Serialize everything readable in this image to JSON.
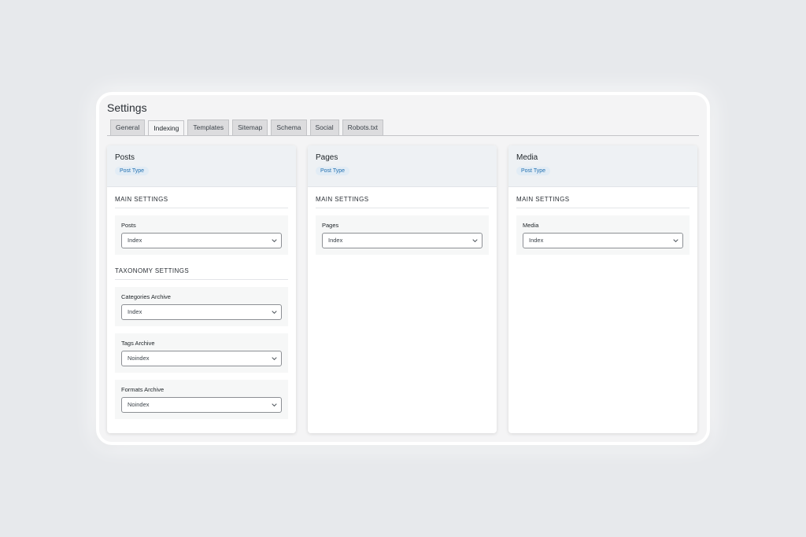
{
  "page_title": "Settings",
  "tabs": [
    "General",
    "Indexing",
    "Templates",
    "Sitemap",
    "Schema",
    "Social",
    "Robots.txt"
  ],
  "active_tab": "Indexing",
  "cards": {
    "posts": {
      "title": "Posts",
      "badge": "Post Type",
      "main_section": "MAIN SETTINGS",
      "posts_field": {
        "label": "Posts",
        "value": "Index"
      },
      "taxonomy_section": "TAXONOMY SETTINGS",
      "categories_field": {
        "label": "Categories Archive",
        "value": "Index"
      },
      "tags_field": {
        "label": "Tags Archive",
        "value": "Noindex"
      },
      "formats_field": {
        "label": "Formats Archive",
        "value": "Noindex"
      }
    },
    "pages": {
      "title": "Pages",
      "badge": "Post Type",
      "main_section": "MAIN SETTINGS",
      "pages_field": {
        "label": "Pages",
        "value": "Index"
      }
    },
    "media": {
      "title": "Media",
      "badge": "Post Type",
      "main_section": "MAIN SETTINGS",
      "media_field": {
        "label": "Media",
        "value": "Index"
      }
    }
  }
}
